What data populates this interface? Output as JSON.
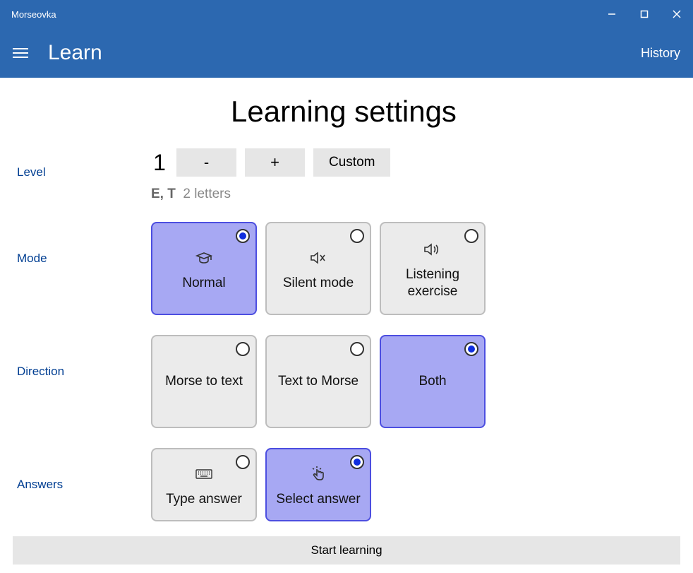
{
  "window": {
    "title": "Morseovka"
  },
  "header": {
    "page_title": "Learn",
    "history_label": "History"
  },
  "main": {
    "heading": "Learning settings",
    "level": {
      "label": "Level",
      "value": "1",
      "minus": "-",
      "plus": "+",
      "custom": "Custom",
      "letters_strong": "E, T",
      "letters_count": "2 letters"
    },
    "mode": {
      "label": "Mode",
      "options": [
        {
          "label": "Normal",
          "selected": true,
          "icon": "academic"
        },
        {
          "label": "Silent mode",
          "selected": false,
          "icon": "mute"
        },
        {
          "label": "Listening exercise",
          "selected": false,
          "icon": "speaker"
        }
      ]
    },
    "direction": {
      "label": "Direction",
      "options": [
        {
          "label": "Morse to text",
          "selected": false
        },
        {
          "label": "Text to Morse",
          "selected": false
        },
        {
          "label": "Both",
          "selected": true
        }
      ]
    },
    "answers": {
      "label": "Answers",
      "options": [
        {
          "label": "Type answer",
          "selected": false,
          "icon": "keyboard"
        },
        {
          "label": "Select answer",
          "selected": true,
          "icon": "pointer"
        }
      ]
    },
    "start_label": "Start learning"
  }
}
